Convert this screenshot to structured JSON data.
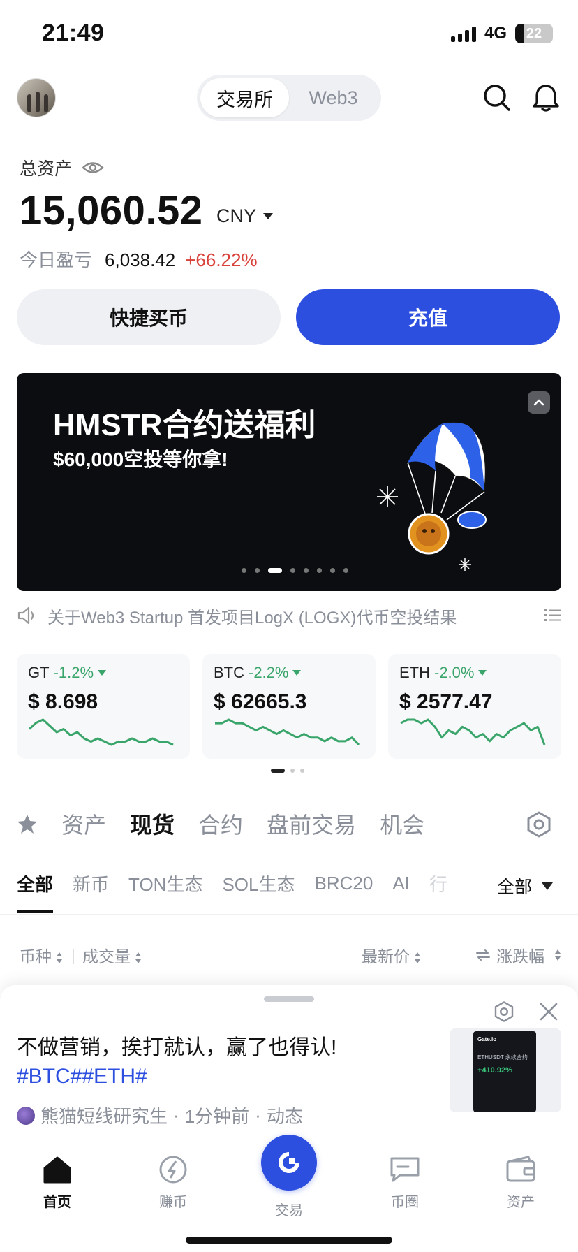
{
  "status_bar": {
    "time": "21:49",
    "network": "4G",
    "battery": "22"
  },
  "header": {
    "tabs": [
      "交易所",
      "Web3"
    ],
    "active_tab": 0
  },
  "assets": {
    "label": "总资产",
    "total": "15,060.52",
    "currency": "CNY",
    "pnl_label": "今日盈亏",
    "pnl_value": "6,038.42",
    "pnl_pct": "+66.22%"
  },
  "actions": {
    "quick_buy": "快捷买币",
    "deposit": "充值"
  },
  "banner": {
    "title": "HMSTR合约送福利",
    "subtitle": "$60,000空投等你拿!",
    "page_count": 8,
    "active_page": 2
  },
  "notice": {
    "text": "关于Web3 Startup 首发项目LogX (LOGX)代币空投结果"
  },
  "tickers": [
    {
      "symbol": "GT",
      "change": "-1.2%",
      "price": "$ 8.698",
      "spark": [
        6,
        8,
        9,
        7,
        5,
        6,
        4,
        5,
        3,
        2,
        3,
        2,
        1,
        2,
        2,
        3,
        2,
        2,
        3,
        2,
        2,
        1
      ]
    },
    {
      "symbol": "BTC",
      "change": "-2.2%",
      "price": "$ 62665.3",
      "spark": [
        7,
        7,
        8,
        7,
        7,
        6,
        5,
        6,
        5,
        4,
        5,
        4,
        3,
        4,
        3,
        3,
        2,
        3,
        2,
        2,
        3,
        1
      ]
    },
    {
      "symbol": "ETH",
      "change": "-2.0%",
      "price": "$ 2577.47",
      "spark": [
        7,
        8,
        8,
        7,
        8,
        6,
        3,
        5,
        4,
        6,
        5,
        3,
        4,
        2,
        4,
        3,
        5,
        6,
        7,
        5,
        6,
        1
      ]
    }
  ],
  "market_tabs": [
    "资产",
    "现货",
    "合约",
    "盘前交易",
    "机会"
  ],
  "market_active": 1,
  "sub_tabs": [
    "全部",
    "新币",
    "TON生态",
    "SOL生态",
    "BRC20",
    "AI",
    "行"
  ],
  "sub_active": 0,
  "filter": {
    "label": "全部"
  },
  "columns": {
    "coin": "币种",
    "volume": "成交量",
    "last_price": "最新价",
    "change": "涨跌幅"
  },
  "post": {
    "title": "不做营销，挨打就认，赢了也得认!",
    "tags": "#BTC##ETH#",
    "author": "熊猫短线研究生",
    "time": "1分钟前",
    "type": "动态",
    "thumb_brand": "Gate.io",
    "thumb_pair": "ETHUSDT 永续合约",
    "thumb_pct": "+410.92%"
  },
  "nav": [
    {
      "label": "首页",
      "icon": "home-icon"
    },
    {
      "label": "赚币",
      "icon": "earn-icon"
    },
    {
      "label": "交易",
      "icon": "trade-icon"
    },
    {
      "label": "币圈",
      "icon": "community-icon"
    },
    {
      "label": "资产",
      "icon": "wallet-icon"
    }
  ],
  "colors": {
    "accent": "#2d4fe0",
    "up": "#d9413b",
    "down": "#3aa56a"
  }
}
